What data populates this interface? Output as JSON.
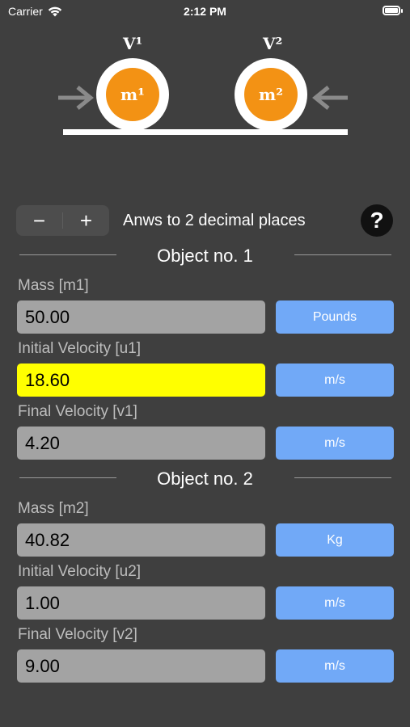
{
  "status": {
    "carrier": "Carrier",
    "time": "2:12 PM"
  },
  "diagram": {
    "v1": "V¹",
    "v2": "V²",
    "m1": "m¹",
    "m2": "m²"
  },
  "controls": {
    "minus": "−",
    "plus": "+",
    "decimal_text": "Anws to 2 decimal places",
    "help": "?"
  },
  "object1": {
    "title": "Object no. 1",
    "mass_label": "Mass [m1]",
    "mass_value": "50.00",
    "mass_unit": "Pounds",
    "u_label": "Initial Velocity [u1]",
    "u_value": "18.60",
    "u_unit": "m/s",
    "v_label": "Final Velocity [v1]",
    "v_value": "4.20",
    "v_unit": "m/s"
  },
  "object2": {
    "title": "Object no. 2",
    "mass_label": "Mass [m2]",
    "mass_value": "40.82",
    "mass_unit": "Kg",
    "u_label": "Initial Velocity [u2]",
    "u_value": "1.00",
    "u_unit": "m/s",
    "v_label": "Final Velocity [v2]",
    "v_value": "9.00",
    "v_unit": "m/s"
  },
  "colors": {
    "background": "#3f3f3f",
    "ball": "#f39214",
    "unit_button": "#71a9f7",
    "input": "#a3a3a3",
    "highlight": "#ffff00"
  }
}
